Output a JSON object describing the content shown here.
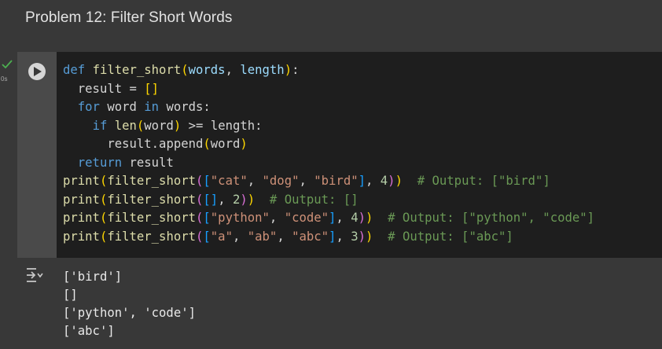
{
  "heading": "Problem 12: Filter Short Words",
  "cell": {
    "exec_time": "0s",
    "status_icon": "check-icon",
    "run_icon": "play-icon",
    "output_icon": "output-toggle-icon"
  },
  "code": {
    "line1": {
      "kw": "def",
      "name": "filter_short",
      "p1": "words",
      "p2": "length"
    },
    "line2": {
      "var": "result",
      "op": " = ",
      "br": "[]"
    },
    "line3": {
      "kw1": "for",
      "var": "word",
      "kw2": "in",
      "iter": "words"
    },
    "line4": {
      "kw": "if",
      "fn": "len",
      "arg": "word",
      "op": " >= ",
      "rhs": "length"
    },
    "line5": {
      "obj": "result.append",
      "arg": "word"
    },
    "line6": {
      "kw": "return",
      "val": "result"
    },
    "calls": [
      {
        "items": [
          "\"cat\"",
          "\"dog\"",
          "\"bird\""
        ],
        "len": "4",
        "comment": "# Output: [\"bird\"]"
      },
      {
        "items": [],
        "len": "2",
        "comment": "# Output: []"
      },
      {
        "items": [
          "\"python\"",
          "\"code\""
        ],
        "len": "4",
        "comment": "# Output: [\"python\", \"code\"]"
      },
      {
        "items": [
          "\"a\"",
          "\"ab\"",
          "\"abc\""
        ],
        "len": "3",
        "comment": "# Output: [\"abc\"]"
      }
    ]
  },
  "output_lines": [
    "['bird']",
    "[]",
    "['python', 'code']",
    "['abc']"
  ],
  "colors": {
    "background": "#383838",
    "code_bg": "#1e1e1e",
    "keyword": "#569cd6",
    "function": "#dcdcaa",
    "string": "#ce9178",
    "number": "#b5cea8",
    "comment": "#6a9955",
    "success_check": "#4caf50"
  }
}
